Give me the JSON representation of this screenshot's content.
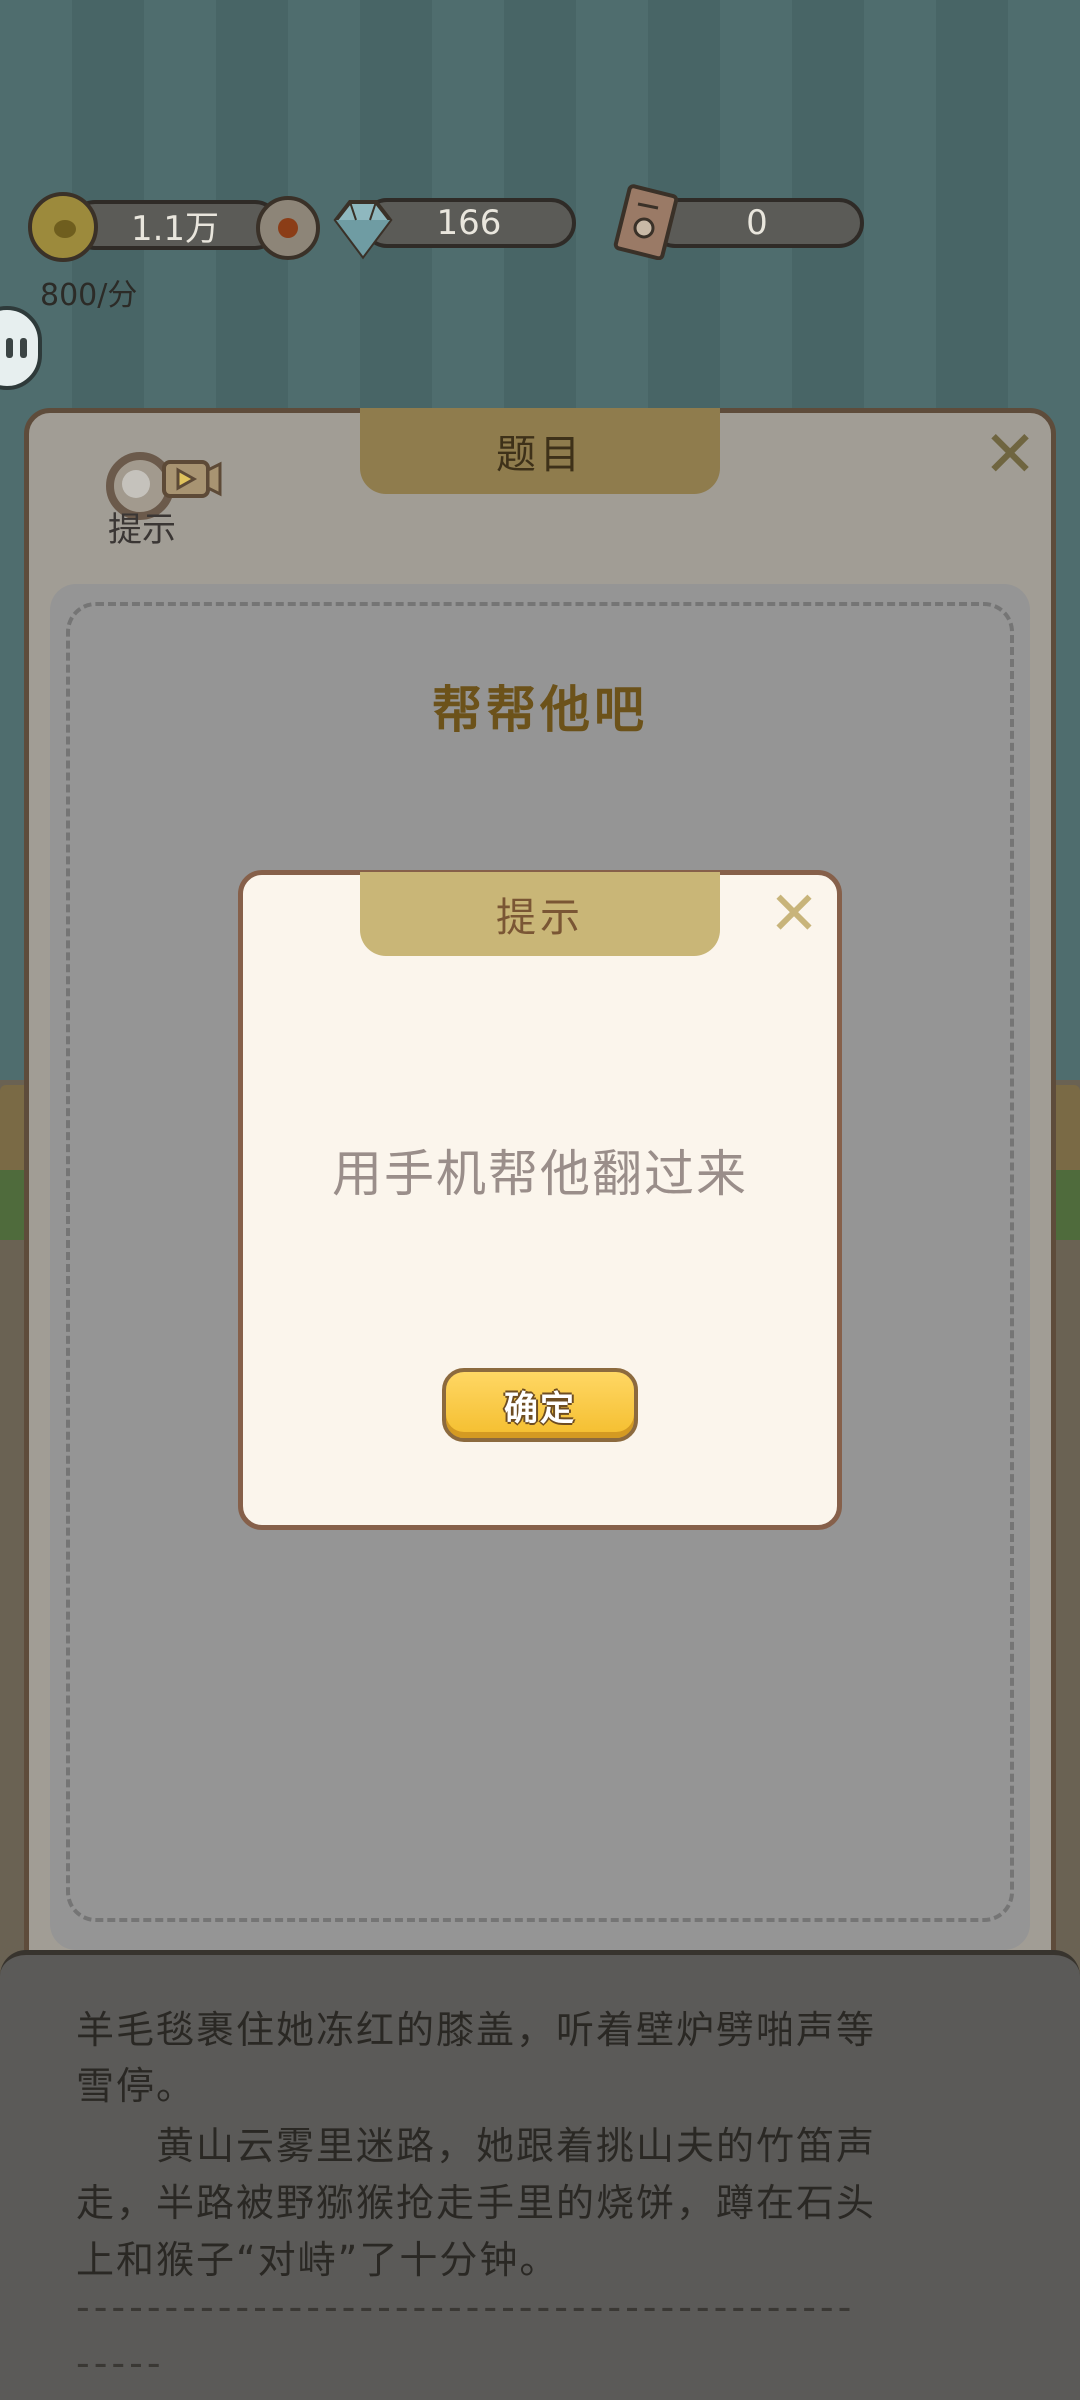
{
  "resources": {
    "coins": "1.1万",
    "diamonds": "166",
    "tickets": "0",
    "rate": "800/分"
  },
  "panel": {
    "title": "题目",
    "close_label": "✕",
    "hint_label": "提示",
    "question": "帮帮他吧"
  },
  "story": {
    "line1": "羊毛毯裹住她冻红的膝盖，听着壁炉劈啪声等",
    "line2": "雪停。",
    "line3": "　　黄山云雾里迷路，她跟着挑山夫的竹笛声",
    "line4": "走，半路被野猕猴抢走手里的烧饼，蹲在石头",
    "line5": "上和猴子“对峙”了十分钟。",
    "line6": "--------------------------------------------",
    "line7": "-----"
  },
  "dialog": {
    "title": "提示",
    "close_label": "✕",
    "message": "用手机帮他翻过来",
    "confirm_label": "确定"
  },
  "icons": {
    "coin": "coin-icon",
    "gear": "gear-icon",
    "diamond": "diamond-icon",
    "ticket": "ticket-icon",
    "hint": "magnifier-video-icon"
  }
}
